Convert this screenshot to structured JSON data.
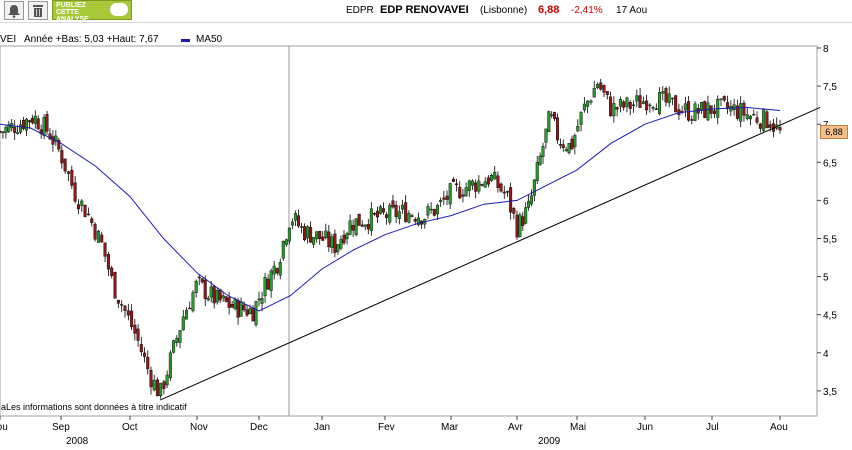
{
  "toolbar": {
    "promo_lines": [
      "PUBLIEZ",
      "CETTE",
      "ANALYSE"
    ]
  },
  "header": {
    "code": "EDPR",
    "name": "EDP RENOVAVEI",
    "exchange": "(Lisbonne)",
    "price": "6,88",
    "change": "-2,41%",
    "date": "17 Aou"
  },
  "subheader": {
    "label_prefix": "VEI",
    "range_text": "Année +Bas: 5,03 +Haut: 7,67",
    "ma_label": "MA50"
  },
  "disclaimer": "aLes informations sont données à titre indicatif",
  "price_tag": "6,88",
  "colors": {
    "up": "#2a9a2a",
    "down": "#8c1a1a",
    "ma": "#1c1cb4",
    "trend": "#000000",
    "header_price": "#cc0000"
  },
  "chart_data": {
    "type": "candlestick",
    "title": "EDP RENOVAVEI",
    "ylim": [
      3.3,
      8.0
    ],
    "y_ticks": [
      "3,5",
      "4",
      "4,5",
      "5",
      "5,5",
      "6",
      "6,5",
      "7",
      "7,5",
      "8"
    ],
    "x_months": [
      "Aou",
      "Sep",
      "Oct",
      "Nov",
      "Dec",
      "Jan",
      "Fev",
      "Mar",
      "Avr",
      "Mai",
      "Jun",
      "Jul",
      "Aou"
    ],
    "x_years": [
      "2008",
      "2009"
    ],
    "close_series": [
      {
        "m": 0.0,
        "v": 6.9
      },
      {
        "m": 0.3,
        "v": 7.0
      },
      {
        "m": 0.55,
        "v": 7.1
      },
      {
        "m": 0.8,
        "v": 6.9
      },
      {
        "m": 1.0,
        "v": 6.6
      },
      {
        "m": 1.2,
        "v": 6.1
      },
      {
        "m": 1.4,
        "v": 5.8
      },
      {
        "m": 1.6,
        "v": 5.4
      },
      {
        "m": 1.75,
        "v": 4.9
      },
      {
        "m": 1.9,
        "v": 4.6
      },
      {
        "m": 2.1,
        "v": 4.2
      },
      {
        "m": 2.3,
        "v": 3.7
      },
      {
        "m": 2.45,
        "v": 3.45
      },
      {
        "m": 2.6,
        "v": 3.9
      },
      {
        "m": 2.8,
        "v": 4.5
      },
      {
        "m": 3.0,
        "v": 4.9
      },
      {
        "m": 3.3,
        "v": 4.7
      },
      {
        "m": 3.6,
        "v": 4.6
      },
      {
        "m": 3.9,
        "v": 4.55
      },
      {
        "m": 4.1,
        "v": 4.9
      },
      {
        "m": 4.3,
        "v": 5.2
      },
      {
        "m": 4.5,
        "v": 5.8
      },
      {
        "m": 4.7,
        "v": 5.6
      },
      {
        "m": 5.0,
        "v": 5.5
      },
      {
        "m": 5.2,
        "v": 5.4
      },
      {
        "m": 5.45,
        "v": 5.7
      },
      {
        "m": 5.7,
        "v": 5.75
      },
      {
        "m": 6.0,
        "v": 5.8
      },
      {
        "m": 6.3,
        "v": 5.85
      },
      {
        "m": 6.6,
        "v": 5.8
      },
      {
        "m": 6.8,
        "v": 5.9
      },
      {
        "m": 7.0,
        "v": 6.1
      },
      {
        "m": 7.3,
        "v": 6.2
      },
      {
        "m": 7.6,
        "v": 6.3
      },
      {
        "m": 7.85,
        "v": 6.05
      },
      {
        "m": 8.0,
        "v": 5.65
      },
      {
        "m": 8.2,
        "v": 5.9
      },
      {
        "m": 8.4,
        "v": 6.6
      },
      {
        "m": 8.55,
        "v": 7.1
      },
      {
        "m": 8.7,
        "v": 6.8
      },
      {
        "m": 8.9,
        "v": 6.7
      },
      {
        "m": 9.1,
        "v": 7.2
      },
      {
        "m": 9.3,
        "v": 7.55
      },
      {
        "m": 9.5,
        "v": 7.2
      },
      {
        "m": 9.8,
        "v": 7.25
      },
      {
        "m": 10.1,
        "v": 7.35
      },
      {
        "m": 10.4,
        "v": 7.25
      },
      {
        "m": 10.7,
        "v": 7.15
      },
      {
        "m": 11.0,
        "v": 7.2
      },
      {
        "m": 11.3,
        "v": 7.2
      },
      {
        "m": 11.6,
        "v": 7.1
      },
      {
        "m": 11.85,
        "v": 7.05
      },
      {
        "m": 12.0,
        "v": 6.88
      }
    ],
    "ma50": [
      {
        "m": 0.0,
        "v": 7.0
      },
      {
        "m": 0.5,
        "v": 6.95
      },
      {
        "m": 1.0,
        "v": 6.75
      },
      {
        "m": 1.5,
        "v": 6.45
      },
      {
        "m": 2.0,
        "v": 6.05
      },
      {
        "m": 2.5,
        "v": 5.5
      },
      {
        "m": 3.0,
        "v": 5.05
      },
      {
        "m": 3.5,
        "v": 4.75
      },
      {
        "m": 4.0,
        "v": 4.55
      },
      {
        "m": 4.5,
        "v": 4.75
      },
      {
        "m": 5.0,
        "v": 5.1
      },
      {
        "m": 5.5,
        "v": 5.35
      },
      {
        "m": 6.0,
        "v": 5.55
      },
      {
        "m": 6.5,
        "v": 5.7
      },
      {
        "m": 7.0,
        "v": 5.8
      },
      {
        "m": 7.5,
        "v": 5.95
      },
      {
        "m": 8.0,
        "v": 6.0
      },
      {
        "m": 8.5,
        "v": 6.2
      },
      {
        "m": 9.0,
        "v": 6.4
      },
      {
        "m": 9.5,
        "v": 6.75
      },
      {
        "m": 10.0,
        "v": 7.0
      },
      {
        "m": 10.5,
        "v": 7.15
      },
      {
        "m": 11.0,
        "v": 7.2
      },
      {
        "m": 11.5,
        "v": 7.22
      },
      {
        "m": 12.0,
        "v": 7.18
      }
    ],
    "trendline": [
      {
        "m": 2.45,
        "v": 3.38
      },
      {
        "m": 12.65,
        "v": 7.22
      }
    ]
  }
}
